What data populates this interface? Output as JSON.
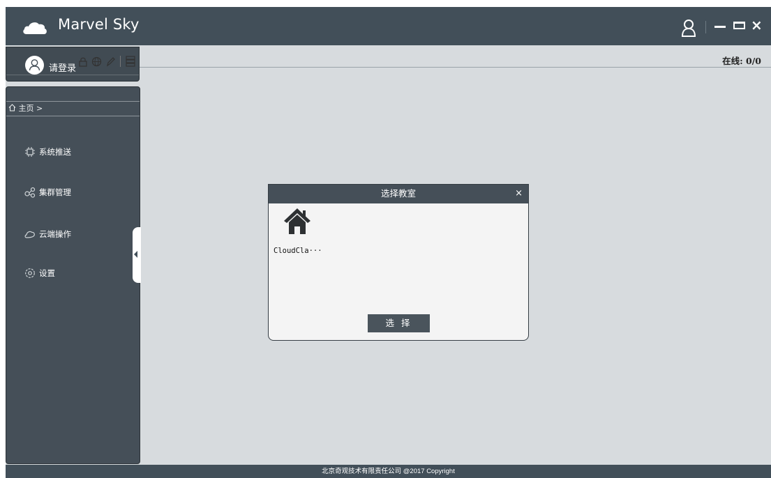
{
  "app": {
    "title": "Marvel Sky",
    "colors": {
      "titlebar": "#424f59",
      "content": "#d7dbde",
      "sidebar": "#454f58"
    }
  },
  "window_controls": {
    "icons": [
      "user-icon",
      "minimize-icon",
      "maximize-icon",
      "close-icon"
    ],
    "close_glyph": "×"
  },
  "status": {
    "online": "在线: 0/0"
  },
  "login": {
    "label": "请登录",
    "tool_icons": [
      "lock-icon",
      "globe-icon",
      "pencil-icon",
      "server-icon"
    ]
  },
  "breadcrumb": {
    "text": "主页 >"
  },
  "sidebar": {
    "items": [
      {
        "label": "系统推送",
        "icon": "chip-icon"
      },
      {
        "label": "集群管理",
        "icon": "cluster-icon"
      },
      {
        "label": "云端操作",
        "icon": "cloud-outline-icon"
      },
      {
        "label": "设置",
        "icon": "settings-icon"
      }
    ]
  },
  "dialog": {
    "title": "选择教室",
    "close": "×",
    "items": [
      {
        "label": "CloudCla···",
        "icon": "house-icon"
      }
    ],
    "button": "选 择"
  },
  "footer": {
    "text": "北京奇观技术有限责任公司   @2017 Copyright"
  }
}
